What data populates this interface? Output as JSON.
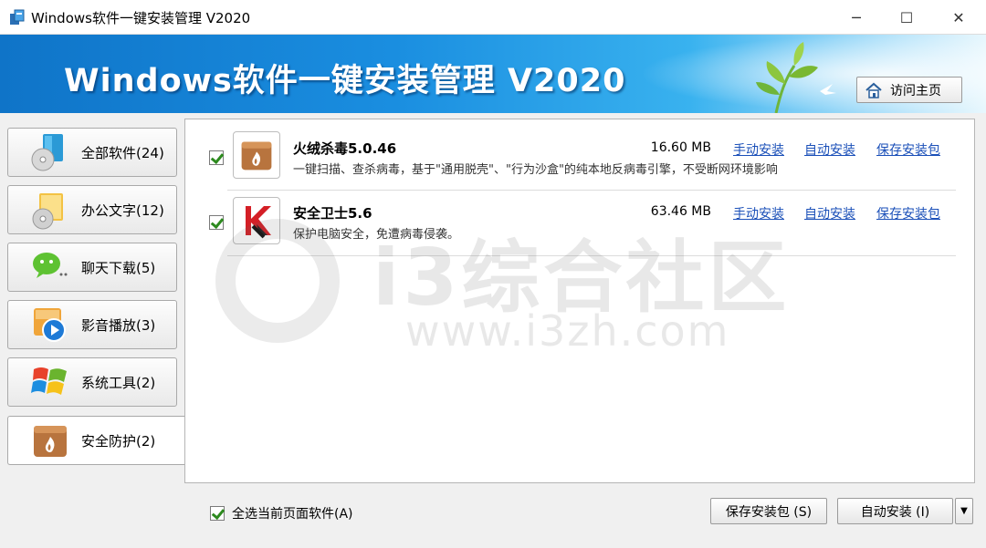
{
  "window": {
    "title": "Windows软件一键安装管理 V2020",
    "minimize": "─",
    "maximize": "☐",
    "close": "✕"
  },
  "banner": {
    "title": "Windows软件一键安装管理  V2020",
    "homepage_button": "访问主页",
    "colors": {
      "start": "#0f74c8",
      "end": "#e8f7fd"
    }
  },
  "sidebar": {
    "items": [
      {
        "label": "全部软件(24)",
        "icon": "disc-box-icon",
        "active": false
      },
      {
        "label": "办公文字(12)",
        "icon": "disc-folder-icon",
        "active": false
      },
      {
        "label": "聊天下载(5)",
        "icon": "wechat-icon",
        "active": false
      },
      {
        "label": "影音播放(3)",
        "icon": "media-player-icon",
        "active": false
      },
      {
        "label": "系统工具(2)",
        "icon": "windows-logo-icon",
        "active": false
      },
      {
        "label": "安全防护(2)",
        "icon": "tinder-box-icon",
        "active": true
      }
    ]
  },
  "software": [
    {
      "name": "火绒杀毒5.0.46",
      "description": "一键扫描、查杀病毒，基于\"通用脱壳\"、\"行为沙盒\"的纯本地反病毒引擎，不受断网环境影响",
      "size": "16.60 MB",
      "manual_install": "手动安装",
      "auto_install": "自动安装",
      "save_package": "保存安装包",
      "icon": "huorong-icon",
      "checked": true
    },
    {
      "name": "安全卫士5.6",
      "description": "保护电脑安全，免遭病毒侵袭。",
      "size": "63.46 MB",
      "manual_install": "手动安装",
      "auto_install": "自动安装",
      "save_package": "保存安装包",
      "icon": "kaspersky-icon",
      "checked": true
    }
  ],
  "watermark": {
    "text": "i3综合社区",
    "url": "www.i3zh.com"
  },
  "footer": {
    "select_all": "全选当前页面软件(A)",
    "save_button": "保存安装包 (S)",
    "auto_button": "自动安装 (I)",
    "dropdown": "▼"
  }
}
